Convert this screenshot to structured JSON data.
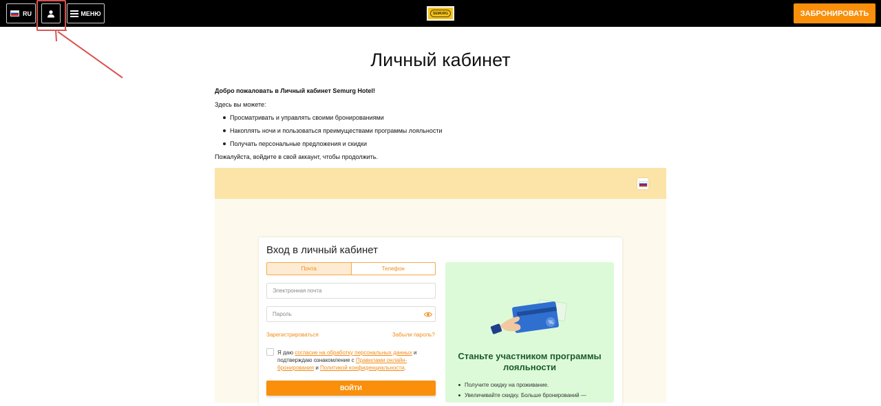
{
  "header": {
    "lang_label": "RU",
    "menu_label": "МЕНЮ",
    "logo_text": "SEMURG",
    "book_label": "ЗАБРОНИРОВАТЬ"
  },
  "page": {
    "title": "Личный кабинет",
    "welcome": "Добро пожаловать в Личный кабинет Semurg Hotel!",
    "can_do": "Здесь вы можете:",
    "bullets": [
      "Просматривать и управлять своими бронированиями",
      "Накоплять ночи и пользоваться преимуществами программы лояльности",
      "Получать персональные предложения и скидки"
    ],
    "please_login": "Пожалуйста, войдите в свой аккаунт, чтобы продолжить."
  },
  "login": {
    "title": "Вход в личный кабинет",
    "tabs": [
      "Почта",
      "Телефон"
    ],
    "active_tab": "Почта",
    "email_placeholder": "Электронная почта",
    "password_placeholder": "Пароль",
    "register_label": "Зарегистрироваться",
    "forgot_label": "Забыли пароль?",
    "consent": {
      "part1": "Я даю ",
      "link1": "согласие на обработку персональных данных",
      "part2": " и подтверждаю ознакомление с ",
      "link2": "Правилами онлайн-бронирования",
      "part3": " и ",
      "link3": "Политикой конфиденциальности",
      "part4": "."
    },
    "submit_label": "ВОЙТИ"
  },
  "promo": {
    "title": "Станьте участником программы лояльности",
    "items": [
      "Получите скидку на проживание.",
      "Увеличивайте скидку. Больше бронирований —"
    ]
  },
  "colors": {
    "accent": "#f98f0b",
    "topbar": "#000000",
    "widget_header": "#fce4a8",
    "promo_bg": "#dcfad8",
    "annotation": "#d9534f"
  },
  "icons": [
    "russia-flag-icon",
    "user-icon",
    "hamburger-menu-icon",
    "eye-icon",
    "card-hand-illustration"
  ]
}
